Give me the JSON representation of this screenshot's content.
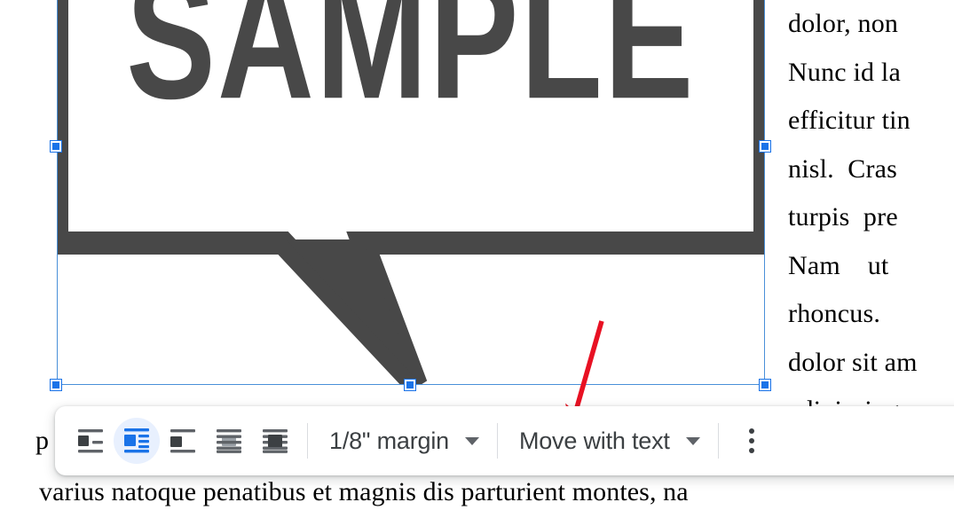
{
  "document": {
    "right_column_lines": [
      "dolor, non",
      "Nunc id la",
      "efficitur tin",
      "nisl.  Cras",
      "turpis  pre",
      "Nam    ut",
      "rhoncus.",
      "dolor sit am",
      "adipiscing"
    ],
    "bottom_line": "varius natoque penatibus et magnis dis parturient montes, na",
    "left_occluded_fragment": "p"
  },
  "image": {
    "alt_text": "SAMPLE",
    "caption_text": "SAMPLE",
    "graphic_name": "speech-bubble-sample",
    "graphic_color": "#484848",
    "selected": true,
    "selection_border_color": "#4a90d9",
    "handle_color": "#1a73e8"
  },
  "annotation": {
    "arrow_color": "#e81123",
    "arrow_name": "red-pointer-arrow",
    "points_at": "1/8\" margin dropdown"
  },
  "toolbar": {
    "name": "image-options-toolbar",
    "wrap_options": [
      {
        "id": "in-line",
        "label": "In line",
        "icon": "wrap-inline-icon",
        "selected": false
      },
      {
        "id": "wrap-text",
        "label": "Wrap text",
        "icon": "wrap-text-icon",
        "selected": true
      },
      {
        "id": "break-text",
        "label": "Break text",
        "icon": "wrap-break-text-icon",
        "selected": false
      },
      {
        "id": "behind-text",
        "label": "Behind text",
        "icon": "wrap-behind-text-icon",
        "selected": false
      },
      {
        "id": "in-front-of-text",
        "label": "In front of text",
        "icon": "wrap-front-text-icon",
        "selected": false
      }
    ],
    "margin_dropdown": {
      "label": "1/8\" margin",
      "icon": "chevron-down-icon"
    },
    "position_dropdown": {
      "label": "Move with text",
      "icon": "chevron-down-icon"
    },
    "more_options": {
      "label": "More image options",
      "icon": "more-vert-icon"
    },
    "accent_color": "#1a73e8",
    "active_bg_color": "#e8f0fe"
  }
}
